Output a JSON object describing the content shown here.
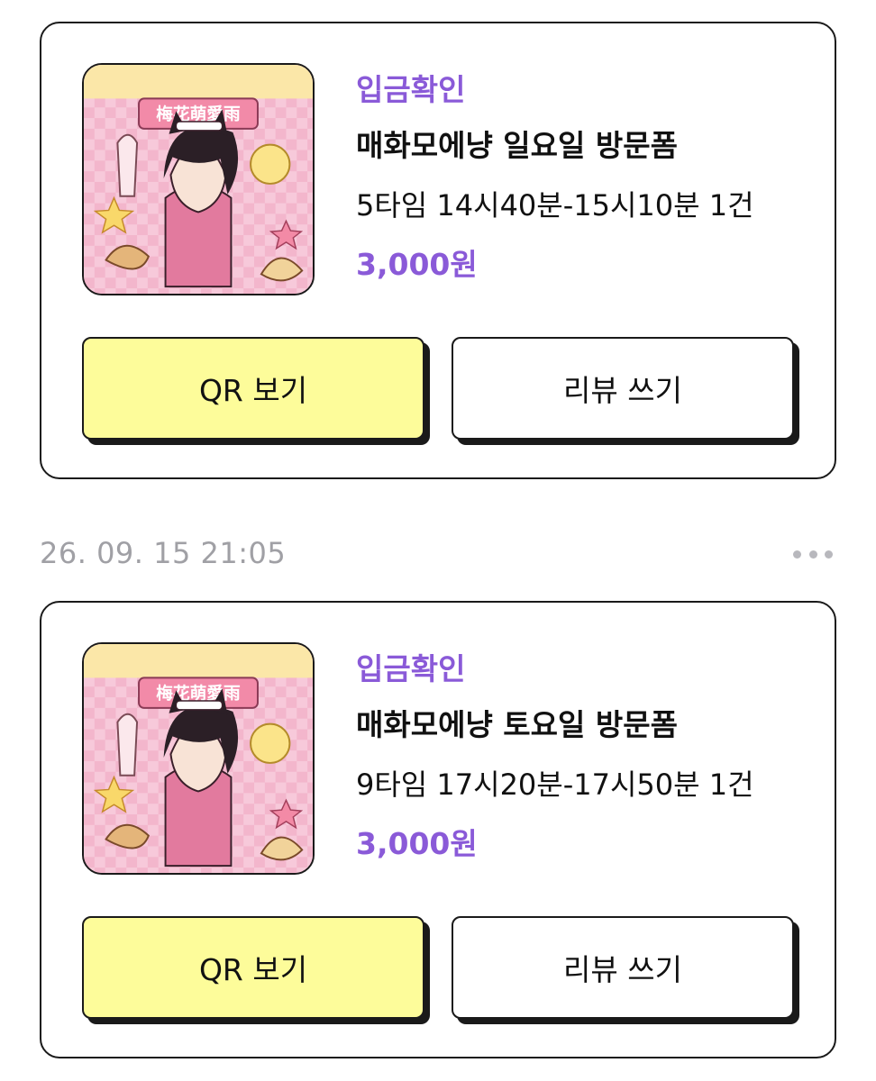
{
  "orders": [
    {
      "status": "입금확인",
      "title": "매화모에냥 일요일 방문폼",
      "detail": "5타임 14시40분-15시10분 1건",
      "price": "3,000원",
      "qr_button": "QR 보기",
      "review_button": "리뷰 쓰기",
      "thumbnail_text": "梅花萌愛雨"
    },
    {
      "timestamp": "26. 09. 15 21:05",
      "status": "입금확인",
      "title": "매화모에냥 토요일 방문폼",
      "detail": "9타임 17시20분-17시50분 1건",
      "price": "3,000원",
      "qr_button": "QR 보기",
      "review_button": "리뷰 쓰기",
      "thumbnail_text": "梅花萌愛雨"
    }
  ],
  "icons": {
    "more": "more-dots-icon"
  },
  "colors": {
    "status": "#8a5ad8",
    "price": "#8a5ad8",
    "qr_button_bg": "#fdfc9a",
    "timestamp": "#a0a0a5"
  }
}
